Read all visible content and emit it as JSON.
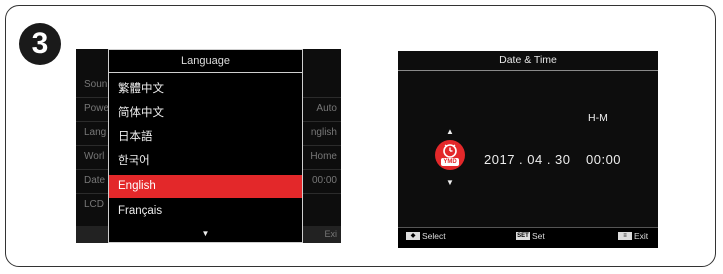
{
  "step_number": "3",
  "left_screen": {
    "title": "Language",
    "items": [
      {
        "label": "繁體中文",
        "selected": false
      },
      {
        "label": "简体中文",
        "selected": false
      },
      {
        "label": "日本語",
        "selected": false
      },
      {
        "label": "한국어",
        "selected": false
      },
      {
        "label": "English",
        "selected": true
      },
      {
        "label": "Français",
        "selected": false
      }
    ],
    "more_indicator": "▼",
    "background_rows": [
      "Soun",
      "Powe",
      "Lang",
      "Worl",
      "Date",
      "LCD"
    ],
    "background_values": [
      "Auto",
      "nglish",
      "Home",
      "00:00"
    ],
    "footer_right": "Exi",
    "selection_color": "#e3282a"
  },
  "right_screen": {
    "title": "Date & Time",
    "format_label": "H-M",
    "date_value": "2017 . 04 . 30",
    "time_value": "00:00",
    "up_arrow": "▲",
    "down_arrow": "▼",
    "clock_icon_text": "YMD",
    "footer": [
      {
        "icon": "four-way-key-icon",
        "label": "Select"
      },
      {
        "icon": "set-key-icon",
        "label": "Set"
      },
      {
        "icon": "menu-key-icon",
        "label": "Exit"
      }
    ],
    "accent_color": "#e3282a"
  }
}
